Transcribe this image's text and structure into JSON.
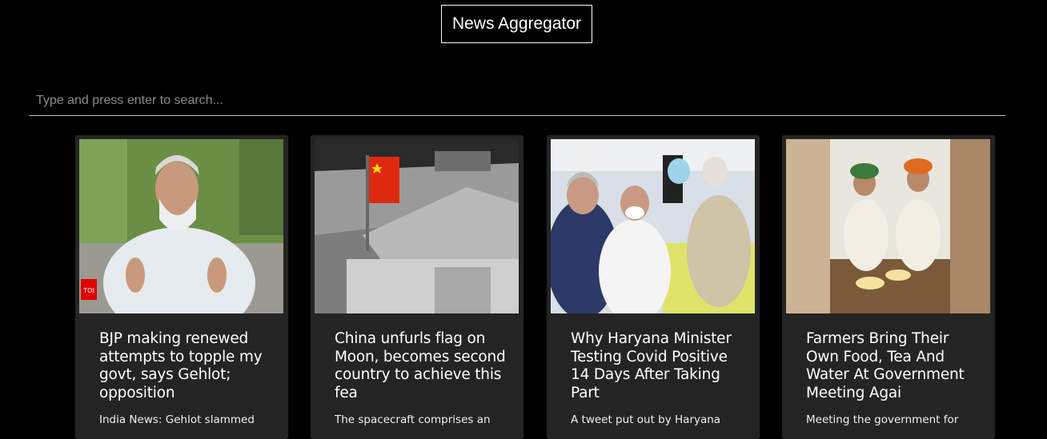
{
  "header": {
    "title": "News Aggregator"
  },
  "search": {
    "placeholder": "Type and press enter to search..."
  },
  "articles": [
    {
      "headline": "BJP making renewed attempts to topple my govt, says Gehlot; opposition",
      "description": "India News: Gehlot slammed",
      "image": "politician-in-white-kurta-photo",
      "logo_text": "TOI"
    },
    {
      "headline": "China unfurls flag on Moon, becomes second country to achieve this fea",
      "description": "The spacecraft comprises an",
      "image": "lunar-lander-with-flag-render"
    },
    {
      "headline": "Why Haryana Minister Testing Covid Positive 14 Days After Taking Part",
      "description": "A tweet put out by Haryana",
      "image": "minister-receiving-vaccine-photo"
    },
    {
      "headline": "Farmers Bring Their Own Food, Tea And Water At Government Meeting Agai",
      "description": "Meeting the government for",
      "image": "farmers-eating-on-floor-photo"
    }
  ],
  "colors": {
    "background": "#000000",
    "card": "#242424",
    "text": "#ffffff",
    "flag_red": "#de2910"
  }
}
